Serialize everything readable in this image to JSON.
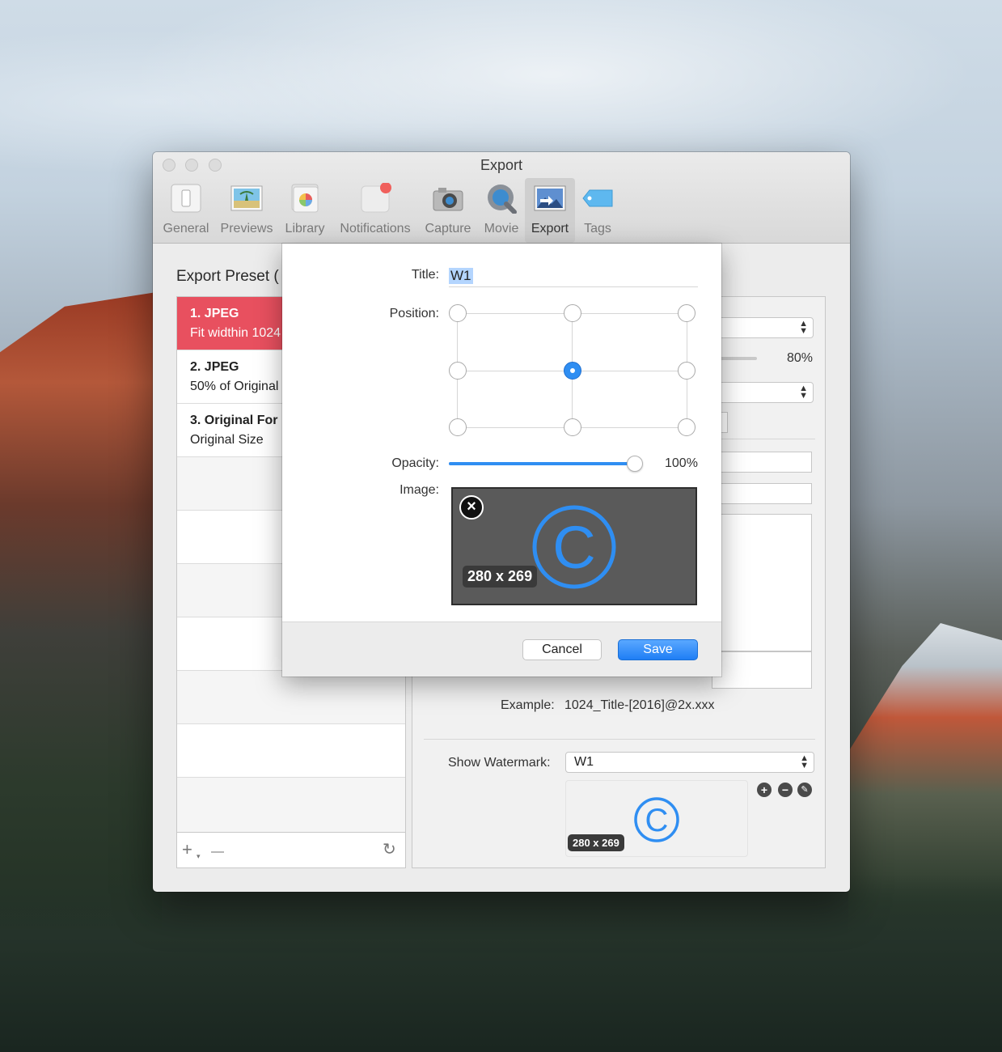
{
  "window": {
    "title": "Export"
  },
  "toolbar": {
    "items": [
      {
        "label": "General",
        "icon": "switch-icon"
      },
      {
        "label": "Previews",
        "icon": "picture-icon"
      },
      {
        "label": "Library",
        "icon": "photos-icon"
      },
      {
        "label": "Notifications",
        "icon": "notification-icon"
      },
      {
        "label": "Capture",
        "icon": "camera-icon"
      },
      {
        "label": "Movie",
        "icon": "quicktime-icon"
      },
      {
        "label": "Export",
        "icon": "export-icon",
        "active": true
      },
      {
        "label": "Tags",
        "icon": "tag-icon"
      }
    ]
  },
  "presets": {
    "heading": "Export Preset (",
    "items": [
      {
        "name": "1. JPEG",
        "desc": "Fit widthin 1024",
        "selected": true
      },
      {
        "name": "2. JPEG",
        "desc": "50% of Original"
      },
      {
        "name": "3. Original For",
        "desc": "Original Size"
      }
    ],
    "footer": {
      "add": "+",
      "add_menu": "▾",
      "remove": "—",
      "refresh": "↻"
    }
  },
  "settings": {
    "quality_value": "80%",
    "example_label": "Example:",
    "example_value": "1024_Title-[2016]@2x.xxx",
    "watermark_label": "Show Watermark:",
    "watermark_value": "W1",
    "watermark_size": "280 x 269",
    "add_btn": "+",
    "remove_btn": "−",
    "edit_btn": "✎"
  },
  "sheet": {
    "title_label": "Title:",
    "title_value": "W1",
    "position_label": "Position:",
    "position_selected": "center",
    "opacity_label": "Opacity:",
    "opacity_value": "100%",
    "opacity_fraction": 1.0,
    "image_label": "Image:",
    "image_size": "280 x 269",
    "image_symbol": "C",
    "remove_image": "×",
    "cancel_label": "Cancel",
    "save_label": "Save"
  },
  "colors": {
    "selected_row": "#e8505f",
    "accent": "#2f8ef2",
    "copyright_blue": "#2f8ef2"
  }
}
